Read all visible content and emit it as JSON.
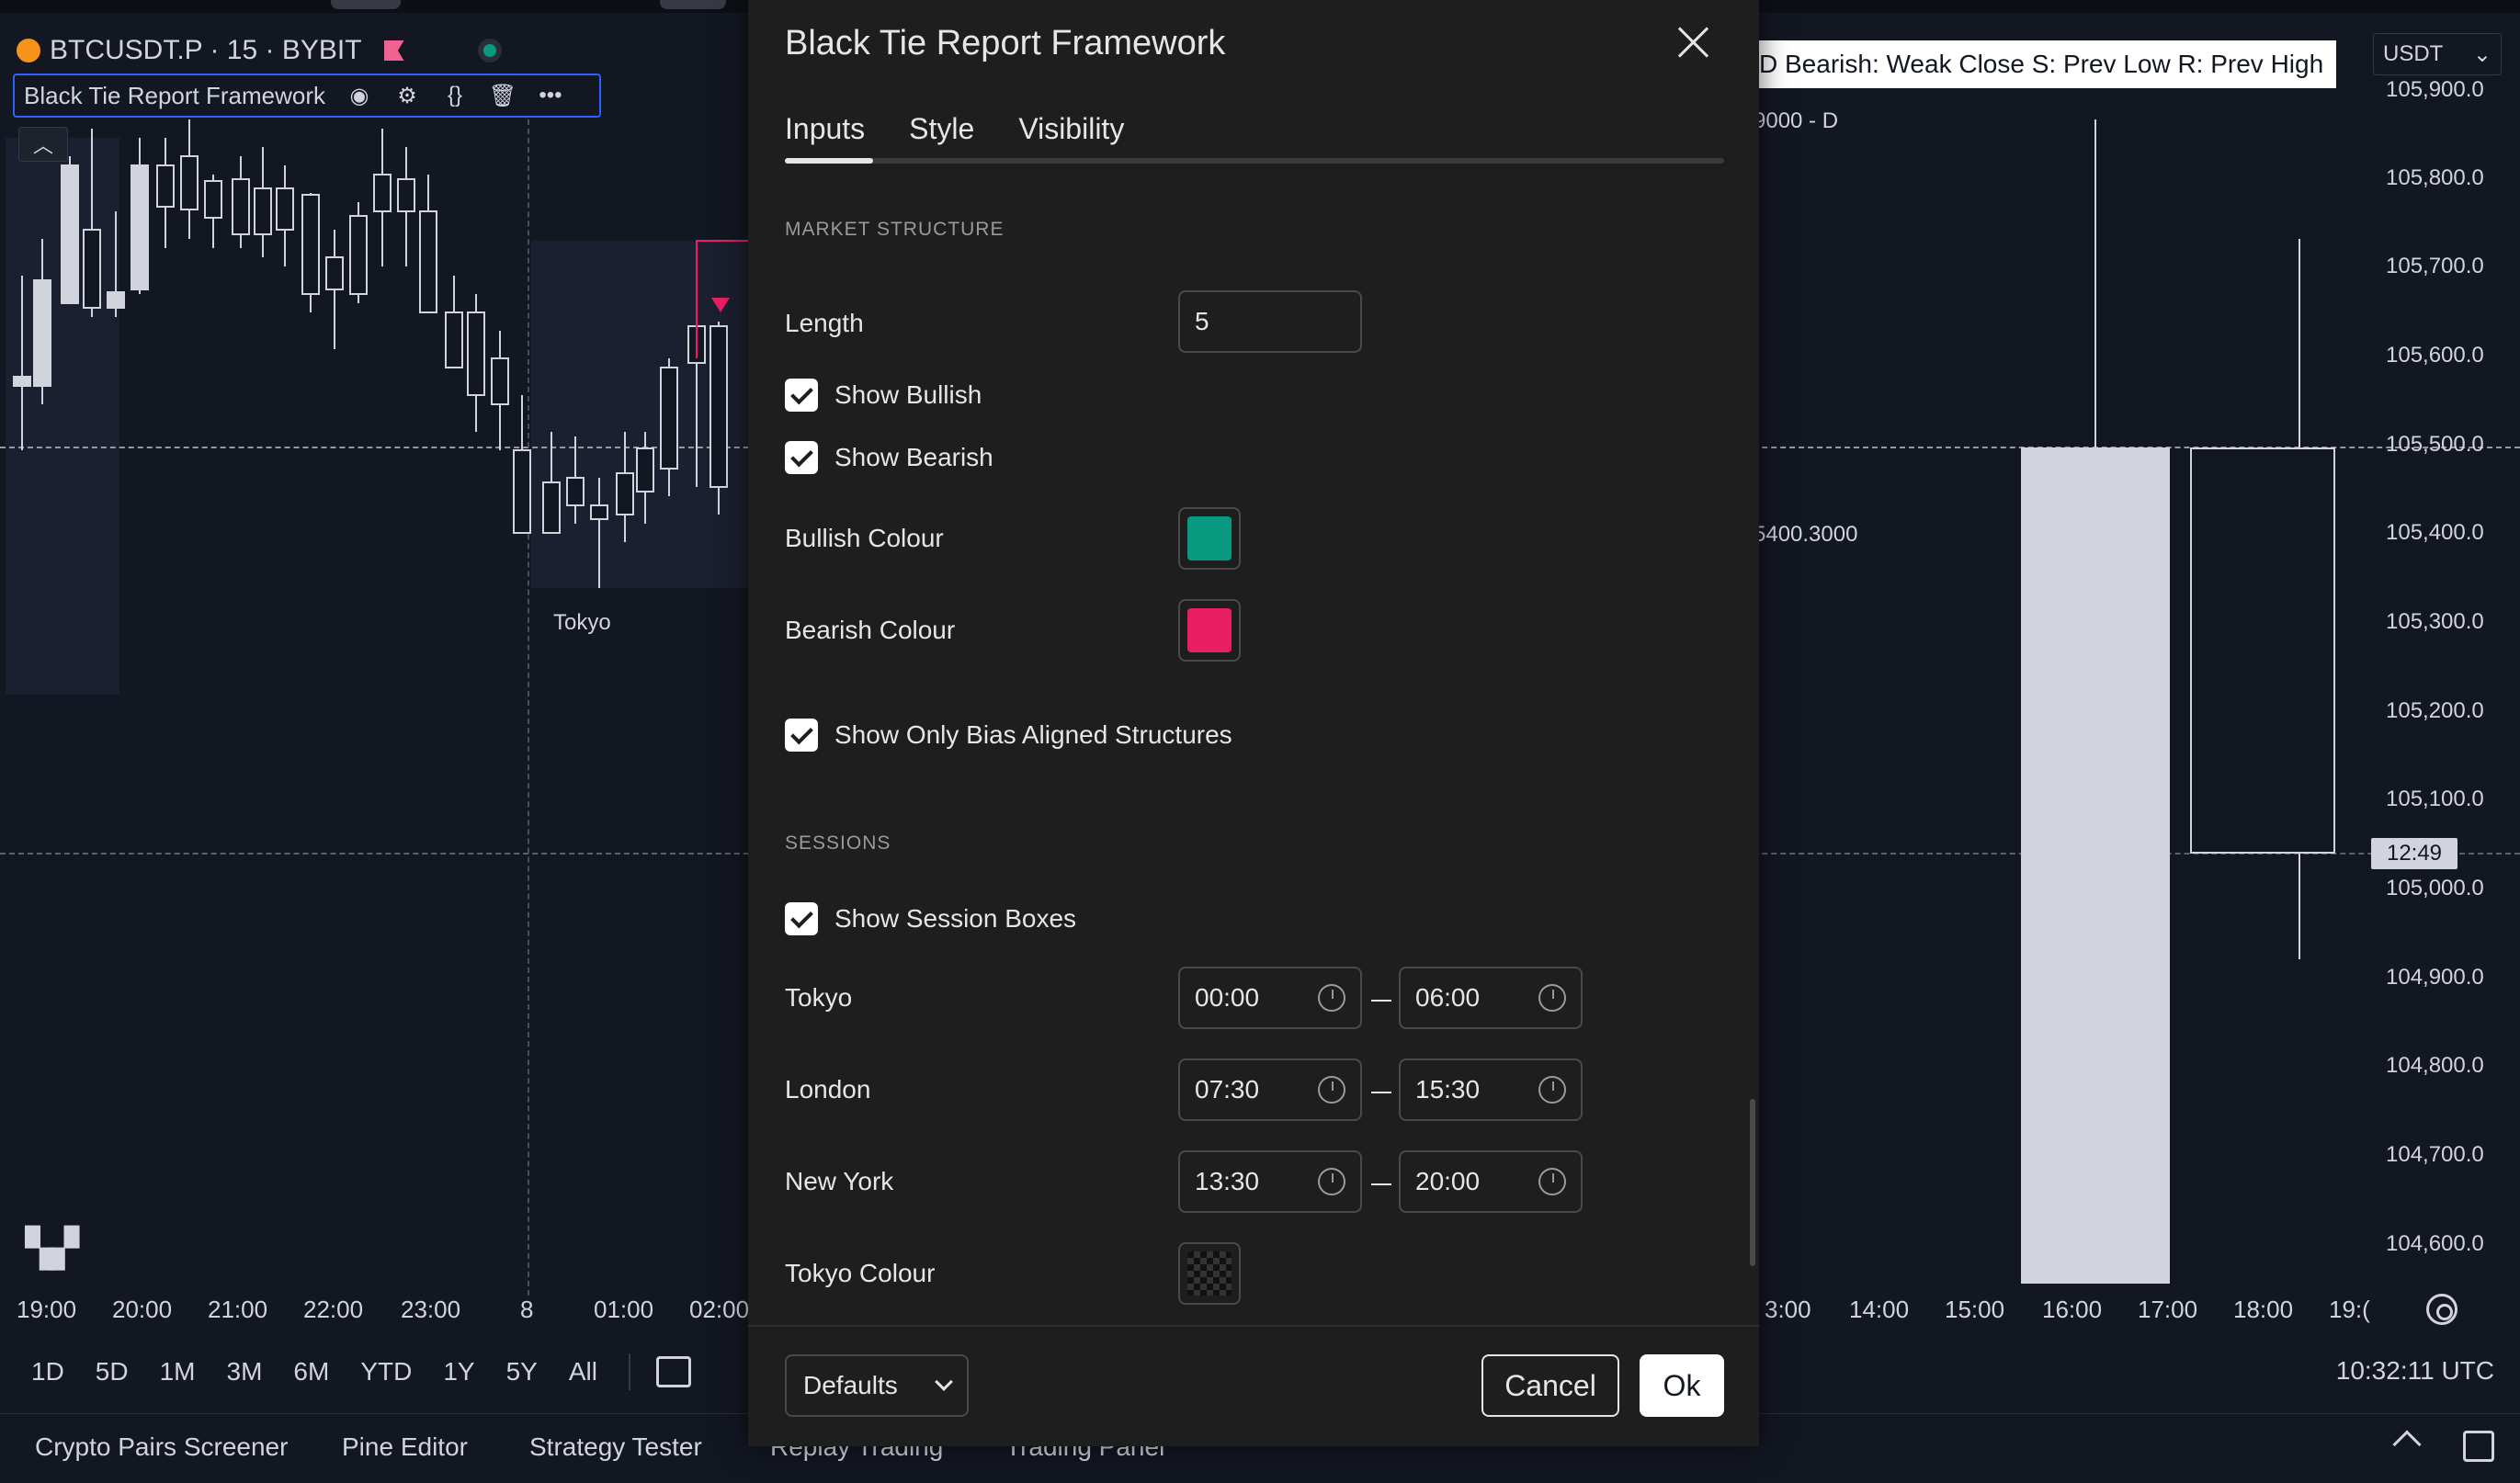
{
  "chart": {
    "symbol": "BTCUSDT.P · 15 · BYBIT",
    "indicator_name": "Black Tie Report Framework",
    "legend_text": "D  Bearish: Weak Close  S: Prev Low  R: Prev High",
    "currency": "USDT",
    "d_label": "9000 - D",
    "price_annotation": "5400.3000",
    "session_label": "Tokyo",
    "countdown": "12:49",
    "price_ticks": [
      "105,900.0",
      "105,800.0",
      "105,700.0",
      "105,600.0",
      "105,500.0",
      "105,400.0",
      "105,300.0",
      "105,200.0",
      "105,100.0",
      "105,000.0",
      "104,900.0",
      "104,800.0",
      "104,700.0",
      "104,600.0"
    ],
    "time_ticks_left": [
      "19:00",
      "20:00",
      "21:00",
      "22:00",
      "23:00",
      "8",
      "01:00",
      "02:00"
    ],
    "time_ticks_right": [
      "3:00",
      "14:00",
      "15:00",
      "16:00",
      "17:00",
      "18:00",
      "19:("
    ],
    "logo": "TV"
  },
  "bottom_bar": {
    "ranges": [
      "1D",
      "5D",
      "1M",
      "3M",
      "6M",
      "YTD",
      "1Y",
      "5Y",
      "All"
    ],
    "clock": "10:32:11 UTC"
  },
  "panel_tabs": [
    "Crypto Pairs Screener",
    "Pine Editor",
    "Strategy Tester",
    "Replay Trading",
    "Trading Panel"
  ],
  "dialog": {
    "title": "Black Tie Report Framework",
    "tabs": [
      "Inputs",
      "Style",
      "Visibility"
    ],
    "active_tab": "Inputs",
    "section_market": "MARKET STRUCTURE",
    "length_label": "Length",
    "length_value": "5",
    "show_bullish": "Show Bullish",
    "show_bearish": "Show Bearish",
    "bullish_colour_label": "Bullish Colour",
    "bullish_colour": "#089981",
    "bearish_colour_label": "Bearish Colour",
    "bearish_colour": "#e91e63",
    "show_bias": "Show Only Bias Aligned Structures",
    "section_sessions": "SESSIONS",
    "show_session_boxes": "Show Session Boxes",
    "sessions": [
      {
        "name": "Tokyo",
        "start": "00:00",
        "end": "06:00"
      },
      {
        "name": "London",
        "start": "07:30",
        "end": "15:30"
      },
      {
        "name": "New York",
        "start": "13:30",
        "end": "20:00"
      }
    ],
    "tokyo_colour_label": "Tokyo Colour",
    "defaults_label": "Defaults",
    "cancel_label": "Cancel",
    "ok_label": "Ok"
  }
}
